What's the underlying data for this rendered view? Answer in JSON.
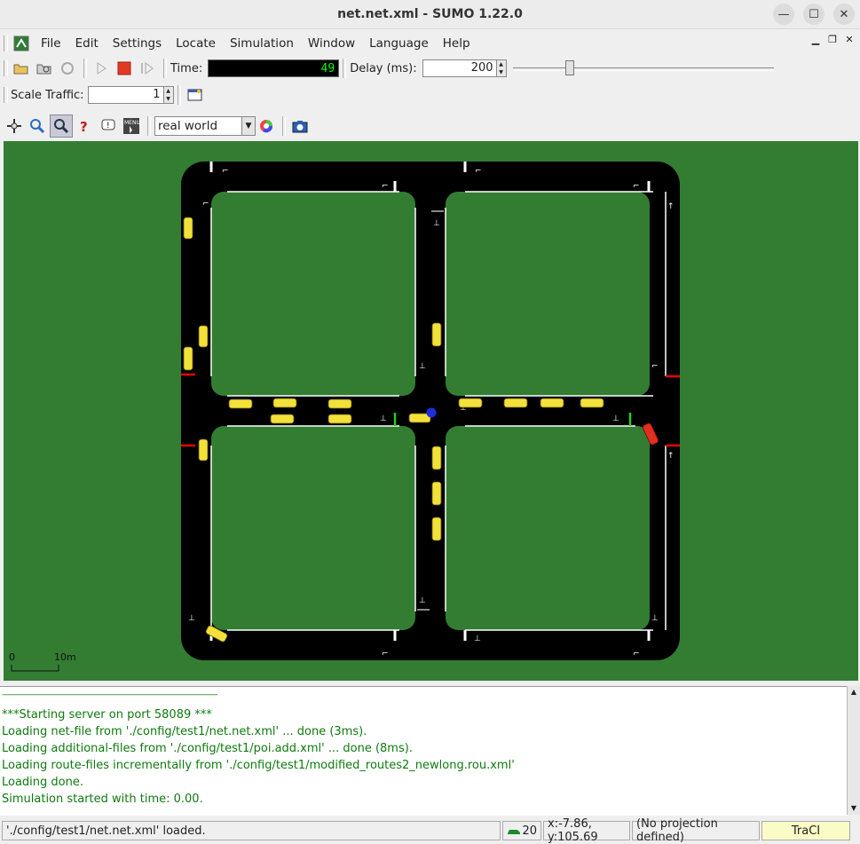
{
  "window": {
    "title": "net.net.xml - SUMO 1.22.0",
    "minimize": "—",
    "maximize": "☐",
    "close": "✕"
  },
  "menu": {
    "items": [
      {
        "label": "File"
      },
      {
        "label": "Edit"
      },
      {
        "label": "Settings"
      },
      {
        "label": "Locate"
      },
      {
        "label": "Simulation"
      },
      {
        "label": "Window"
      },
      {
        "label": "Language"
      },
      {
        "label": "Help"
      }
    ]
  },
  "toolbar": {
    "time_label": "Time:",
    "time_value": "49",
    "delay_label": "Delay (ms):",
    "delay_value": "200",
    "delay_level_fraction": 0.21,
    "scale_label": "Scale Traffic:",
    "scale_value": "1",
    "scheme_value": "real world"
  },
  "canvas": {
    "scale_zero": "0",
    "scale_ten": "10m",
    "background_color": "#327d32"
  },
  "messages": [
    "------------------------------------------------------------------------------------------------------------",
    "***Starting server on port 58089 ***",
    "Loading net-file from './config/test1/net.net.xml' ... done (3ms).",
    "Loading additional-files from './config/test1/poi.add.xml' ... done (8ms).",
    "Loading route-files incrementally from './config/test1/modified_routes2_newlong.rou.xml'",
    "Loading done.",
    "Simulation started with time: 0.00."
  ],
  "status": {
    "loaded_text": "'./config/test1/net.net.xml' loaded.",
    "vehicle_count": "20",
    "coords": "x:-7.86, y:105.69",
    "projection": "(No projection defined)",
    "traci": "TraCI"
  }
}
